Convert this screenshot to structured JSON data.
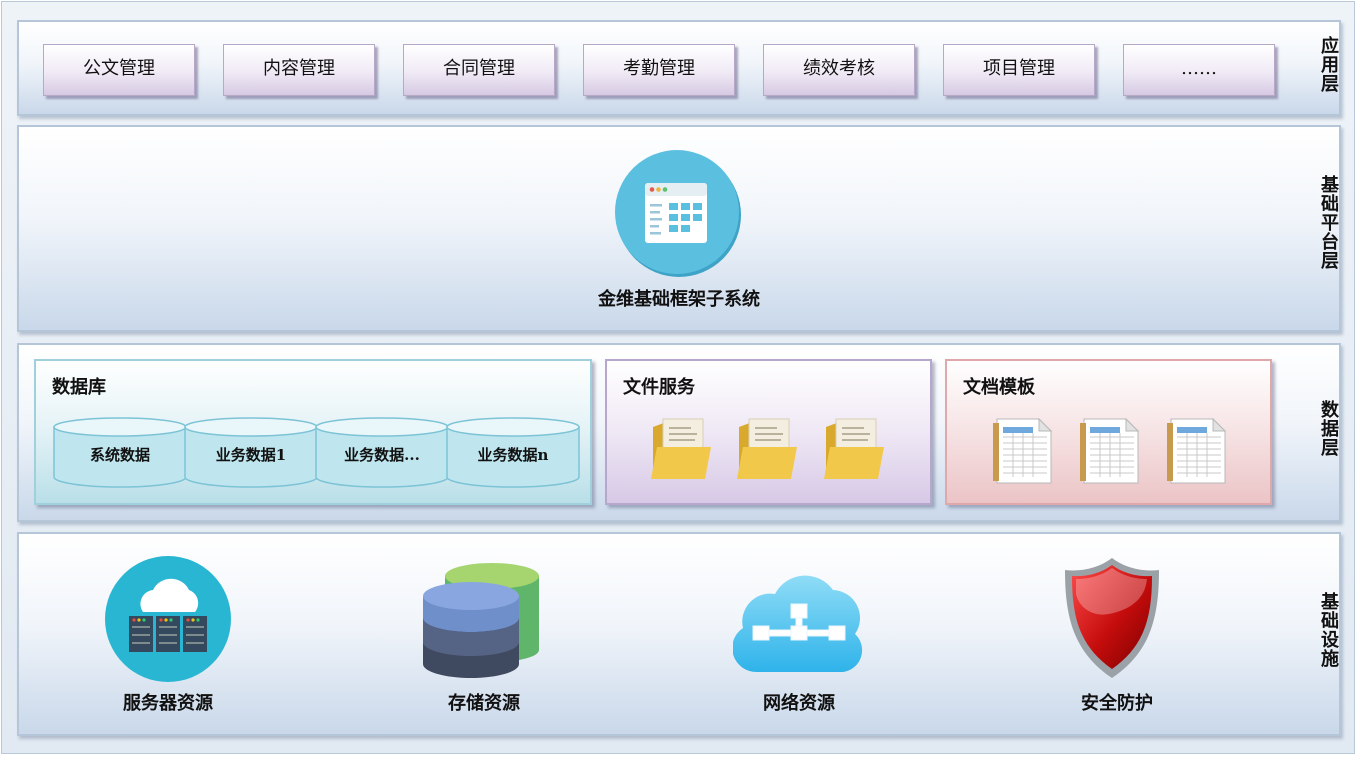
{
  "layers": {
    "application": {
      "label": "应用层",
      "modules": [
        "公文管理",
        "内容管理",
        "合同管理",
        "考勤管理",
        "绩效考核",
        "项目管理",
        "……"
      ]
    },
    "platform": {
      "label": "基础平台层",
      "system_name": "金维基础框架子系统",
      "icon": "browser-window-icon"
    },
    "data": {
      "label": "数据层",
      "database": {
        "title": "数据库",
        "items": [
          "系统数据",
          "业务数据1",
          "业务数据...",
          "业务数据n"
        ]
      },
      "file_service": {
        "title": "文件服务",
        "icon": "folder-icon"
      },
      "doc_template": {
        "title": "文档模板",
        "icon": "spreadsheet-document-icon"
      }
    },
    "infrastructure": {
      "label": "基础设施",
      "items": [
        {
          "label": "服务器资源",
          "icon": "server-cloud-icon"
        },
        {
          "label": "存储资源",
          "icon": "storage-stack-icon"
        },
        {
          "label": "网络资源",
          "icon": "network-cloud-icon"
        },
        {
          "label": "安全防护",
          "icon": "shield-icon"
        }
      ]
    }
  },
  "colors": {
    "layer_border": "#b5c6d8",
    "module_fill": "#e6ddef",
    "database_panel": "#c8e6ee",
    "file_panel": "#e5dbee",
    "template_panel": "#f3d9da",
    "platform_icon": "#5bc0e0"
  }
}
